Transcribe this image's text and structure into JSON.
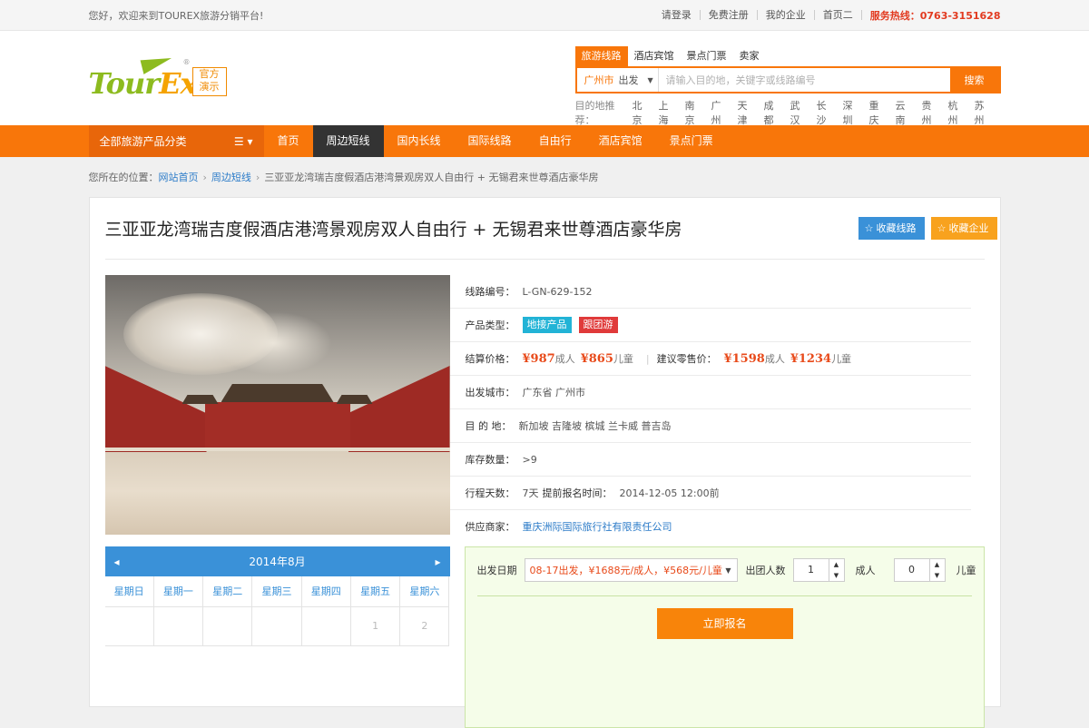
{
  "topbar": {
    "welcome": "您好，欢迎来到TOUREX旅游分销平台!",
    "links": [
      "请登录",
      "免费注册",
      "我的企业",
      "首页二"
    ],
    "hotline": "服务热线：0763-3151628"
  },
  "logo": {
    "text_a": "Tour",
    "text_b": "Ex",
    "badge_line1": "官方",
    "badge_line2": "演示",
    "reg": "®"
  },
  "search": {
    "tabs": [
      "旅游线路",
      "酒店宾馆",
      "景点门票",
      "卖家"
    ],
    "active_tab": 0,
    "city": "广州市",
    "direction": "出发",
    "placeholder": "请输入目的地，关键字或线路编号",
    "button": "搜索",
    "hot_label": "目的地推荐：",
    "hot_cities": [
      "北京",
      "上海",
      "南京",
      "广州",
      "天津",
      "成都",
      "武汉",
      "长沙",
      "深圳",
      "重庆",
      "云南",
      "贵州",
      "杭州",
      "苏州"
    ]
  },
  "nav": {
    "category": "全部旅游产品分类",
    "items": [
      "首页",
      "周边短线",
      "国内长线",
      "国际线路",
      "自由行",
      "酒店宾馆",
      "景点门票"
    ],
    "active": 1
  },
  "breadcrumb": {
    "prefix": "您所在的位置：",
    "items": [
      "网站首页",
      "周边短线"
    ],
    "current": "三亚亚龙湾瑞吉度假酒店港湾景观房双人自由行 + 无锡君来世尊酒店豪华房"
  },
  "product": {
    "title": "三亚亚龙湾瑞吉度假酒店港湾景观房双人自由行 + 无锡君来世尊酒店豪华房",
    "fav_route": "收藏线路",
    "fav_corp": "收藏企业",
    "code_label": "线路编号：",
    "code": "L-GN-629-152",
    "type_label": "产品类型：",
    "type_tags": [
      "地接产品",
      "跟团游"
    ],
    "settle_label": "结算价格：",
    "settle_adult": "¥987",
    "settle_child": "¥865",
    "retail_label": "建议零售价：",
    "retail_adult": "¥1598",
    "retail_child": "¥1234",
    "unit_adult": "成人",
    "unit_child": "儿童",
    "depart_label": "出发城市：",
    "depart": "广东省 广州市",
    "dest_label": "目 的 地：",
    "dest": "新加坡 吉隆坡 槟城 兰卡威 普吉岛",
    "stock_label": "库存数量：",
    "stock": ">9",
    "days_label": "行程天数：",
    "days": "7天",
    "deadline_label": "提前报名时间：",
    "deadline": "2014-12-05 12:00前",
    "supplier_label": "供应商家：",
    "supplier": "重庆洲际国际旅行社有限责任公司"
  },
  "calendar": {
    "month": "2014年8月",
    "weekdays": [
      "星期日",
      "星期一",
      "星期二",
      "星期三",
      "星期四",
      "星期五",
      "星期六"
    ],
    "first_row": [
      "",
      "",
      "",
      "",
      "",
      "1",
      "2"
    ]
  },
  "booking": {
    "date_label": "出发日期",
    "date_value": "08-17出发，¥1688元/成人，¥568元/儿童",
    "people_label": "出团人数",
    "adults": "1",
    "adult_unit": "成人",
    "children": "0",
    "child_unit": "儿童",
    "submit": "立即报名"
  },
  "colors": {
    "accent": "#f8760a",
    "nav_active": "#333333",
    "link": "#2b7bc8",
    "price": "#e84a1a"
  }
}
